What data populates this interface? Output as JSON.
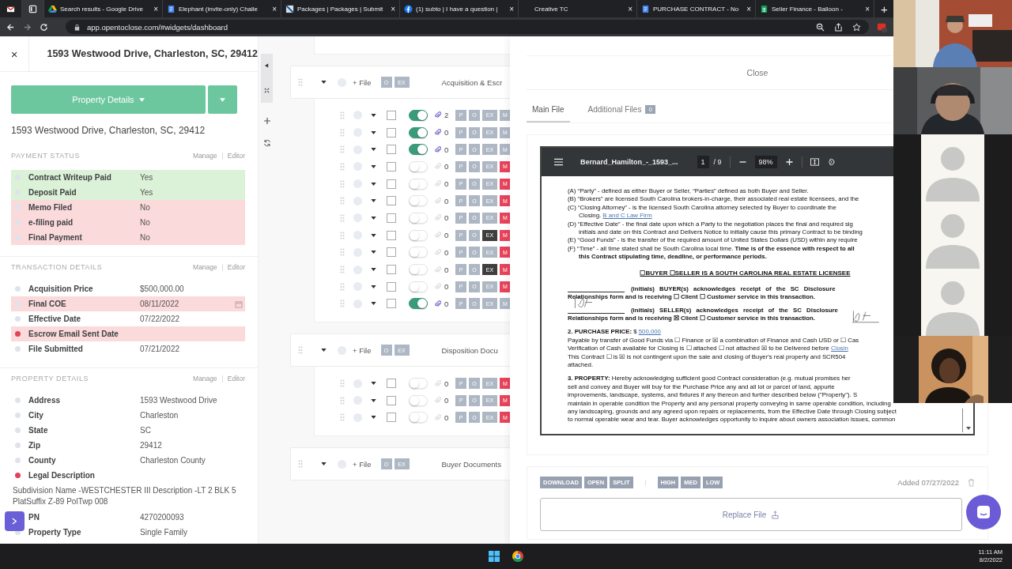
{
  "browser": {
    "tabs": [
      {
        "kind": "pinned",
        "selected": false
      },
      {
        "kind": "pinned",
        "selected": true
      },
      {
        "kind": "page",
        "title": "Search results - Google Drive",
        "selected": false
      },
      {
        "kind": "page",
        "title": "Elephant (invite-only) Challe",
        "selected": false
      },
      {
        "kind": "page",
        "title": "Packages | Packages | Submit",
        "selected": false
      },
      {
        "kind": "page",
        "title": "(1) subto | I have a question |",
        "selected": false
      },
      {
        "kind": "page",
        "title": "Creative TC",
        "selected": false
      },
      {
        "kind": "page",
        "title": "PURCHASE CONTRACT - No",
        "selected": false
      },
      {
        "kind": "page",
        "title": "Seller Finance - Balloon -",
        "selected": false
      }
    ],
    "new_tab": "+",
    "close_mark": "×",
    "url": "app.opentoclose.com/#widgets/dashboard"
  },
  "detail_panel": {
    "close": "×",
    "title": "1593 Westwood Drive, Charleston, SC, 29412",
    "view_button": "Property Details",
    "address": "1593 Westwood Drive, Charleston, SC, 29412",
    "sections": [
      {
        "title": "PAYMENT STATUS",
        "links": [
          "Manage",
          "Editor"
        ],
        "rows": [
          {
            "label": "Contract Writeup Paid",
            "value": "Yes",
            "complete": true,
            "color": "#dfe3ea",
            "kind": "text"
          },
          {
            "label": "Deposit Paid",
            "value": "Yes",
            "complete": true,
            "color": "#dfe3ea",
            "kind": "text"
          },
          {
            "label": "Memo Filed",
            "value": "No",
            "complete": false,
            "color": "#dfe3ea",
            "kind": "text"
          },
          {
            "label": "e-filing paid",
            "value": "No",
            "complete": false,
            "color": "#dfe3ea",
            "kind": "text"
          },
          {
            "label": "Final Payment",
            "value": "No",
            "complete": false,
            "color": "#dfe3ea",
            "kind": "text"
          }
        ]
      },
      {
        "title": "TRANSACTION DETAILS",
        "links": [
          "Manage",
          "Editor"
        ],
        "rows": [
          {
            "label": "Acquisition Price",
            "value": "$500,000.00",
            "color": "#dfe3ea",
            "kind": "text"
          },
          {
            "label": "Final COE",
            "value": "08/11/2022",
            "complete": false,
            "color": "#dfe3ea",
            "kind": "date"
          },
          {
            "label": "Effective Date",
            "value": "07/22/2022",
            "color": "#dfe3ea",
            "kind": "text"
          },
          {
            "label": "Escrow Email Sent Date",
            "complete": false,
            "color": "#e0435a",
            "kind": "text"
          },
          {
            "label": "File Submitted",
            "value": "07/21/2022",
            "color": "#dfe3ea",
            "kind": "text"
          }
        ]
      },
      {
        "title": "PROPERTY DETAILS",
        "links": [
          "Manage",
          "Editor"
        ],
        "rows": [
          {
            "label": "Address",
            "value": "1593 Westwood Drive",
            "color": "#dfe3ea",
            "kind": "text"
          },
          {
            "label": "City",
            "value": "Charleston",
            "color": "#dfe3ea",
            "kind": "text"
          },
          {
            "label": "State",
            "value": "SC",
            "color": "#dfe3ea",
            "kind": "text"
          },
          {
            "label": "Zip",
            "value": "29412",
            "color": "#dfe3ea",
            "kind": "text"
          },
          {
            "label": "County",
            "value": "Charleston County",
            "color": "#dfe3ea",
            "kind": "text"
          },
          {
            "label": "Legal Description",
            "value": "Subdivision Name -WESTCHESTER III Description -LT 2 BLK 5 PlatSuffix Z-89 PolTwp 008",
            "color": "#e0435a",
            "kind": "long"
          },
          {
            "label": "PN",
            "value": "4270200093",
            "kind": "text"
          },
          {
            "label": "Property Type",
            "value": "Single Family",
            "color": "#dfe3ea",
            "kind": "text"
          }
        ]
      }
    ]
  },
  "documents": {
    "groups": [
      {
        "add": "+ File",
        "chips": [
          "O",
          "EX"
        ],
        "title": "Acquisition & Escr",
        "rows": [
          {
            "checked": false,
            "on": true,
            "count": "2",
            "chips": [
              {
                "label": "P",
                "active": false
              },
              {
                "label": "O",
                "active": false
              },
              {
                "label": "EX",
                "active": false
              },
              {
                "label": "M",
                "active": false
              }
            ]
          },
          {
            "checked": false,
            "on": true,
            "count": "0",
            "chips": [
              {
                "label": "P",
                "active": false
              },
              {
                "label": "O",
                "active": false
              },
              {
                "label": "EX",
                "active": false
              },
              {
                "label": "M",
                "active": false
              }
            ]
          },
          {
            "checked": false,
            "on": true,
            "count": "0",
            "chips": [
              {
                "label": "P",
                "active": false
              },
              {
                "label": "O",
                "active": false
              },
              {
                "label": "EX",
                "active": false
              },
              {
                "label": "M",
                "active": false
              }
            ]
          },
          {
            "checked": false,
            "on": false,
            "count": "0",
            "chips": [
              {
                "label": "P",
                "active": false
              },
              {
                "label": "O",
                "active": false
              },
              {
                "label": "EX",
                "active": false
              },
              {
                "label": "M",
                "active": true
              }
            ]
          },
          {
            "checked": false,
            "on": false,
            "count": "0",
            "chips": [
              {
                "label": "P",
                "active": false
              },
              {
                "label": "O",
                "active": false
              },
              {
                "label": "EX",
                "active": false
              },
              {
                "label": "M",
                "active": true
              }
            ]
          },
          {
            "checked": false,
            "on": false,
            "count": "0",
            "chips": [
              {
                "label": "P",
                "active": false
              },
              {
                "label": "O",
                "active": false
              },
              {
                "label": "EX",
                "active": false
              },
              {
                "label": "M",
                "active": true
              }
            ]
          },
          {
            "checked": false,
            "on": false,
            "count": "0",
            "chips": [
              {
                "label": "P",
                "active": false
              },
              {
                "label": "O",
                "active": false
              },
              {
                "label": "EX",
                "active": false
              },
              {
                "label": "M",
                "active": true
              }
            ]
          },
          {
            "checked": false,
            "on": false,
            "count": "0",
            "chips": [
              {
                "label": "P",
                "active": false
              },
              {
                "label": "O",
                "active": false
              },
              {
                "label": "EX",
                "active": true
              },
              {
                "label": "M",
                "active": true
              }
            ]
          },
          {
            "checked": false,
            "on": false,
            "count": "0",
            "chips": [
              {
                "label": "P",
                "active": false
              },
              {
                "label": "O",
                "active": false
              },
              {
                "label": "EX",
                "active": false
              },
              {
                "label": "M",
                "active": true
              }
            ]
          },
          {
            "checked": false,
            "on": false,
            "count": "0",
            "chips": [
              {
                "label": "P",
                "active": false
              },
              {
                "label": "O",
                "active": false
              },
              {
                "label": "EX",
                "active": true
              },
              {
                "label": "M",
                "active": true
              }
            ]
          },
          {
            "checked": false,
            "on": false,
            "count": "0",
            "chips": [
              {
                "label": "P",
                "active": false
              },
              {
                "label": "O",
                "active": false
              },
              {
                "label": "EX",
                "active": false
              },
              {
                "label": "M",
                "active": true
              }
            ]
          },
          {
            "checked": false,
            "on": true,
            "count": "0",
            "chips": [
              {
                "label": "P",
                "active": false
              },
              {
                "label": "O",
                "active": false
              },
              {
                "label": "EX",
                "active": false
              },
              {
                "label": "M",
                "active": false
              }
            ]
          }
        ]
      },
      {
        "add": "+ File",
        "chips": [
          "O",
          "EX"
        ],
        "title": "Disposition Docu",
        "rows": [
          {
            "checked": false,
            "on": false,
            "count": "0",
            "chips": [
              {
                "label": "P",
                "active": false
              },
              {
                "label": "O",
                "active": false
              },
              {
                "label": "EX",
                "active": false
              },
              {
                "label": "M",
                "active": true
              }
            ]
          },
          {
            "checked": false,
            "on": false,
            "count": "0",
            "chips": [
              {
                "label": "P",
                "active": false
              },
              {
                "label": "O",
                "active": false
              },
              {
                "label": "EX",
                "active": false
              },
              {
                "label": "M",
                "active": true
              }
            ]
          },
          {
            "checked": false,
            "on": false,
            "count": "0",
            "chips": [
              {
                "label": "P",
                "active": false
              },
              {
                "label": "O",
                "active": false
              },
              {
                "label": "EX",
                "active": false
              },
              {
                "label": "M",
                "active": true
              }
            ]
          }
        ]
      },
      {
        "add": "+ File",
        "chips": [
          "O",
          "EX"
        ],
        "title": "Buyer Documents"
      }
    ]
  },
  "file_viewer": {
    "close": "Close",
    "tabs": [
      {
        "label": "Main File",
        "selected": true
      },
      {
        "label": "Additional Files",
        "badge": "0",
        "selected": false
      }
    ],
    "pdf": {
      "filename": "Bernard_Hamilton_-_1593_...",
      "page": "1",
      "pages": "/ 9",
      "zoom": "98%",
      "lines": [
        {
          "kind": "item",
          "text": "(A) “Party” - defined as either Buyer or Seller, “Parties” defined as both Buyer and Seller."
        },
        {
          "kind": "item",
          "text": "(B) “Brokers” are licensed South Carolina brokers-in-charge, their associated real estate licensees, and the"
        },
        {
          "kind": "item",
          "text": "(C) “Closing Attorney” - is the licensed South Carolina attorney selected by Buyer to coordinate the"
        },
        {
          "kind": "cont",
          "text": "Closing.",
          "link": "B and C Law Firm"
        },
        {
          "kind": "item",
          "text": "(D) “Effective Date” - the final date upon which a Party to the negotiation places the final and required sig"
        },
        {
          "kind": "cont",
          "text": "initials and date on this Contract and Delivers Notice to initially cause this primary Contract to be binding"
        },
        {
          "kind": "item",
          "text": "(E) “Good Funds” - is the transfer of the required amount of United States Dollars (USD) within any require"
        },
        {
          "kind": "item",
          "text": "(F) “Time” - all time stated shall be South Carolina local time. **Time is of the essence with respect to all**"
        },
        {
          "kind": "bold_cont",
          "text": "this Contract stipulating time, deadline, or performance periods."
        },
        {
          "kind": "heading",
          "text": "☐BUYER ☐SELLER IS A SOUTH CAROLINA REAL ESTATE LICENSEE"
        },
        {
          "kind": "initials",
          "text": "(initials) BUYER(s) acknowledges receipt of the SC Disclosure"
        },
        {
          "kind": "bold",
          "text": "Relationships form and is receiving ☐ Client ☐ Customer service in this transaction."
        },
        {
          "kind": "initials",
          "text": "(initials) SELLER(s) acknowledges receipt of the SC Disclosure"
        },
        {
          "kind": "bold",
          "text": "Relationships form and is receiving ☒ Client ☐ Customer service in this transaction."
        },
        {
          "kind": "section",
          "text": "**2. PURCHASE PRICE:** $",
          "link": "500,000"
        },
        {
          "kind": "plain",
          "text": "Payable by transfer of Good Funds via ☐ Finance or ☒ a combination of Finance and Cash USD or ☐ Cas"
        },
        {
          "kind": "plain",
          "text": "Verification of Cash available for Closing is ☐ attached ☐ not attached ☒ to be Delivered before",
          "link": "Closin"
        },
        {
          "kind": "plain",
          "text": "This Contract ☐ is ☒ is not contingent upon the sale and closing of Buyer's real property and SCR504"
        },
        {
          "kind": "plain",
          "text": "attached."
        },
        {
          "kind": "section",
          "text": "**3. PROPERTY:** Hereby acknowledging sufficient good Contract consideration (e.g. mutual promises her"
        },
        {
          "kind": "plain",
          "text": "sell and convey and Buyer will buy for the Purchase Price any and all lot or parcel of land, appurte"
        },
        {
          "kind": "plain",
          "text": "improvements, landscape, systems, and fixtures if any thereon and further described below (\"Property\"). S"
        },
        {
          "kind": "plain",
          "text": "maintain in operable condition the Property and any personal property conveying in same operable condition, including"
        },
        {
          "kind": "plain",
          "text": "any landscaping, grounds and any agreed upon repairs or replacements, from the Effective Date through Closing subject"
        },
        {
          "kind": "plain",
          "text": "to normal operable wear and tear. Buyer acknowledges opportunity to inquire about owners association issues, common"
        }
      ]
    },
    "actions": [
      "DOWNLOAD",
      "OPEN",
      "SPLIT"
    ],
    "priorities": [
      "HIGH",
      "MED",
      "LOW"
    ],
    "added": "Added 07/27/2022",
    "replace": "Replace File"
  },
  "video_tiles": [
    {
      "kind": "picture"
    },
    {
      "kind": "picture"
    },
    {
      "kind": "avatar"
    },
    {
      "kind": "avatar"
    },
    {
      "kind": "avatar"
    },
    {
      "kind": "picture"
    }
  ],
  "taskbar": {
    "time": "11:11 AM",
    "date": "8/2/2022"
  }
}
